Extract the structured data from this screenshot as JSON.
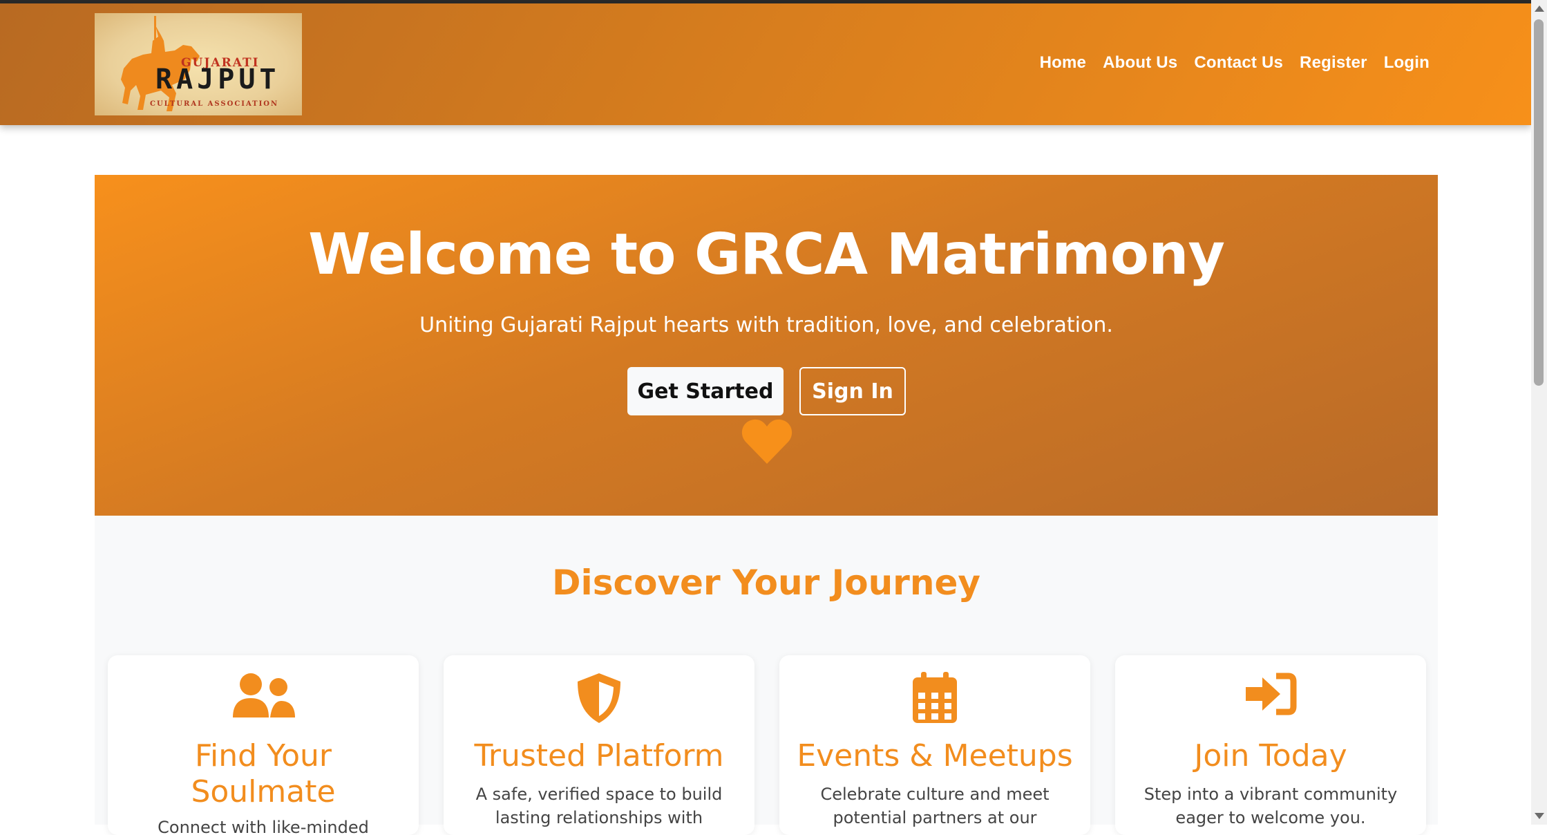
{
  "logo": {
    "top_text": "GUJARATI",
    "main_text": "RAJPUT",
    "bottom_text": "CULTURAL ASSOCIATION"
  },
  "nav": {
    "items": [
      "Home",
      "About Us",
      "Contact Us",
      "Register",
      "Login"
    ]
  },
  "hero": {
    "title": "Welcome to GRCA Matrimony",
    "subtitle": "Uniting Gujarati Rajput hearts with tradition, love, and celebration.",
    "primary_button": "Get Started",
    "secondary_button": "Sign In",
    "decor_icon": "heart-icon"
  },
  "journey": {
    "title": "Discover Your Journey",
    "cards": [
      {
        "icon": "users-icon",
        "title": "Find Your Soulmate",
        "text": "Connect with like-minded"
      },
      {
        "icon": "shield-icon",
        "title": "Trusted Platform",
        "text": "A safe, verified space to build lasting relationships with"
      },
      {
        "icon": "calendar-icon",
        "title": "Events & Meetups",
        "text": "Celebrate culture and meet potential partners at our"
      },
      {
        "icon": "sign-in-icon",
        "title": "Join Today",
        "text": "Step into a vibrant community eager to welcome you."
      }
    ]
  },
  "colors": {
    "accent": "#f28d1e",
    "nav_gradient_start": "#b86a22",
    "nav_gradient_end": "#f7901a",
    "section_bg": "#f8f9fa"
  }
}
